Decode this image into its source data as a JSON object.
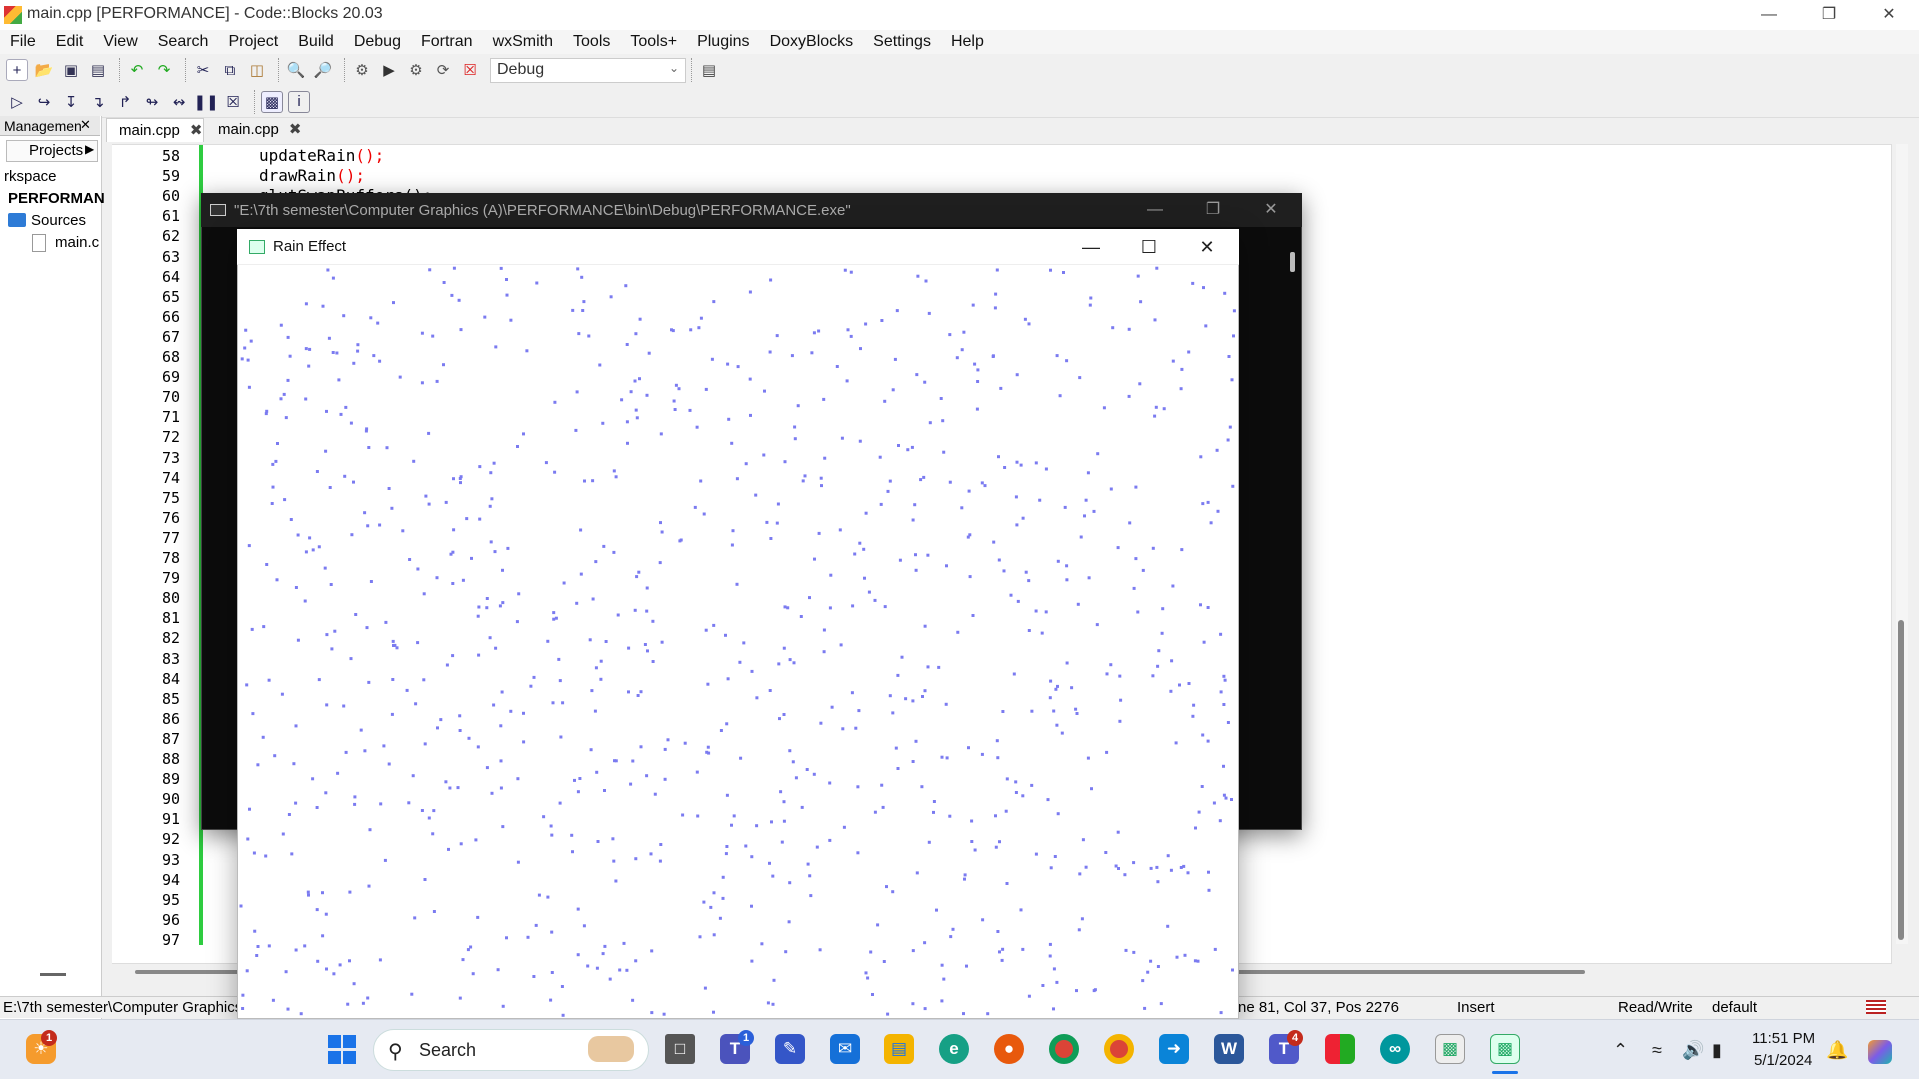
{
  "app": {
    "title": "main.cpp [PERFORMANCE] - Code::Blocks 20.03"
  },
  "window_controls": {
    "minimize": "—",
    "restore": "❐",
    "close": "✕"
  },
  "menu": [
    "File",
    "Edit",
    "View",
    "Search",
    "Project",
    "Build",
    "Debug",
    "Fortran",
    "wxSmith",
    "Tools",
    "Tools+",
    "Plugins",
    "DoxyBlocks",
    "Settings",
    "Help"
  ],
  "toolbar": {
    "build_target": "Debug",
    "main_icons": [
      "new-file-icon",
      "open-icon",
      "save-icon",
      "save-all-icon",
      "undo-icon",
      "redo-icon",
      "cut-icon",
      "copy-icon",
      "paste-icon",
      "find-icon",
      "replace-icon",
      "build-icon",
      "run-icon",
      "build-run-icon",
      "rebuild-icon",
      "abort-icon"
    ],
    "debug_icons": [
      "debug-run-icon",
      "run-to-cursor-icon",
      "next-line-icon",
      "step-into-icon",
      "step-out-icon",
      "next-instruction-icon",
      "step-into-instruction-icon",
      "break-icon",
      "stop-debugger-icon",
      "debug-windows-icon",
      "info-icon"
    ]
  },
  "management": {
    "tab_label": "Managemen",
    "projects_tab": "Projects",
    "workspace": "rkspace",
    "project": "PERFORMAN",
    "sources": "Sources",
    "file": "main.c"
  },
  "editor": {
    "tabs": [
      "main.cpp",
      "main.cpp"
    ],
    "line_numbers": [
      "58",
      "59",
      "60",
      "61",
      "62",
      "63",
      "64",
      "65",
      "66",
      "67",
      "68",
      "69",
      "70",
      "71",
      "72",
      "73",
      "74",
      "75",
      "76",
      "77",
      "78",
      "79",
      "80",
      "81",
      "82",
      "83",
      "84",
      "85",
      "86",
      "87",
      "88",
      "89",
      "90",
      "91",
      "92",
      "93",
      "94",
      "95",
      "96",
      "97"
    ],
    "code": {
      "l58_fn": "updateRain",
      "l58_rest": "();",
      "l59_fn": "drawRain",
      "l59_rest": "();",
      "l60": "glutSwapBuffers();"
    }
  },
  "statusbar": {
    "path": "E:\\7th semester\\Computer Graphics",
    "position": "ne 81, Col 37, Pos 2276",
    "mode": "Insert",
    "access": "Read/Write",
    "config": "default"
  },
  "console": {
    "title": "\"E:\\7th semester\\Computer Graphics (A)\\PERFORMANCE\\bin\\Debug\\PERFORMANCE.exe\""
  },
  "rain_window": {
    "title": "Rain Effect",
    "drop_color": "#7b7bf0"
  },
  "taskbar": {
    "search_placeholder": "Search",
    "apps": [
      "start-icon",
      "task-view-icon",
      "teams-icon",
      "editor-icon",
      "mail-icon",
      "file-explorer-icon",
      "edge-icon",
      "firefox-icon",
      "chrome-icon",
      "chrome-profile-icon",
      "remote-desktop-icon",
      "word-icon",
      "teams-work-icon",
      "office-icon",
      "arduino-icon",
      "codeblocks-icon",
      "rain-app-icon"
    ],
    "badges": {
      "widgets": "1",
      "teams": "1",
      "teams_work": "4"
    },
    "time": "11:51 PM",
    "date": "5/1/2024"
  }
}
